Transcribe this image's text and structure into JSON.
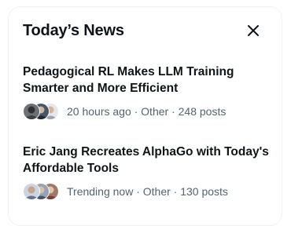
{
  "widget": {
    "title": "Today’s News",
    "close_icon": "close-icon"
  },
  "stories": [
    {
      "headline": "Pedagogical RL Makes LLM Training Smarter and More Efficient",
      "time": "20 hours ago",
      "category": "Other",
      "posts": "248 posts",
      "meta": "20 hours ago · Other · 248 posts"
    },
    {
      "headline": "Eric Jang Recreates AlphaGo with Today's Affordable Tools",
      "time": "Trending now",
      "category": "Other",
      "posts": "130 posts",
      "meta": "Trending now · Other · 130 posts"
    }
  ],
  "colors": {
    "text_primary": "#0f1419",
    "text_secondary": "#536471",
    "border": "#eff3f4"
  }
}
